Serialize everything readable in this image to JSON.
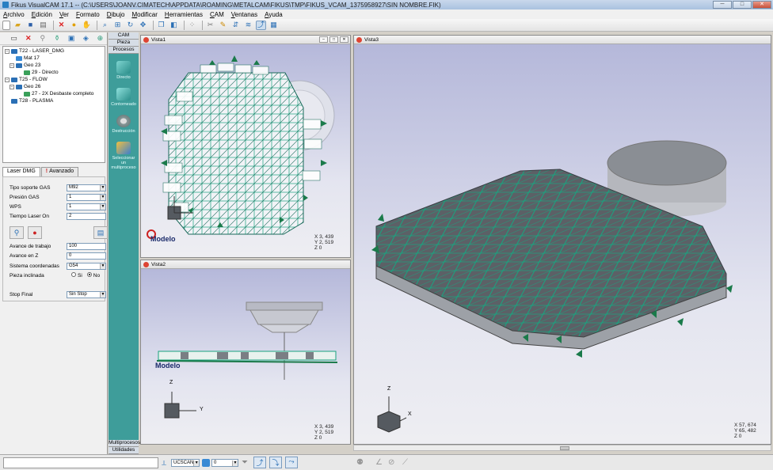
{
  "window": {
    "title": "Fikus VisualCAM 17.1 -- (C:\\USERS\\JOANV.CIMATECH\\APPDATA\\ROAMING\\METALCAM\\FIKUS\\TMP\\FIKUS_VCAM_1375958927\\SIN NOMBRE.FIK)"
  },
  "menu": [
    "Archivo",
    "Edición",
    "Ver",
    "Formato",
    "Dibujo",
    "Modificar",
    "Herramientas",
    "CAM",
    "Ventanas",
    "Ayuda"
  ],
  "toolbar_icons": [
    "new-file-icon",
    "open-folder-icon",
    "save-icon",
    "print-icon",
    "delete-icon",
    "paint-icon",
    "pan-icon",
    "zoom-icon",
    "zoom-window-icon",
    "rotate-icon",
    "move-icon",
    "view-front-icon",
    "view-iso-icon",
    "snap-icon",
    "cut-icon",
    "pen-icon",
    "measure-icon",
    "layers-icon",
    "toolpath-icon",
    "render-icon"
  ],
  "tree": [
    {
      "label": "T22 - LASER_DMG",
      "level": 0
    },
    {
      "label": "Mat 17",
      "level": 1
    },
    {
      "label": "Geo 23",
      "level": 1
    },
    {
      "label": "29 - Directo",
      "level": 2
    },
    {
      "label": "T25 - FLOW",
      "level": 0
    },
    {
      "label": "Geo 26",
      "level": 1
    },
    {
      "label": "27 - 2X Desbaste completo",
      "level": 2
    },
    {
      "label": "T28 - PLASMA",
      "level": 0
    }
  ],
  "tabs": {
    "laser": "Laser DMG",
    "advanced": "Avanzado"
  },
  "form": {
    "tipo_soporte_gas": {
      "label": "Tipo soporte GAS",
      "value": "M92"
    },
    "presion_gas": {
      "label": "Presión GAS",
      "value": "1"
    },
    "wps": {
      "label": "WPS",
      "value": "1"
    },
    "tiempo_laser": {
      "label": "Tiempo Laser On",
      "value": "2"
    },
    "avance_trabajo": {
      "label": "Avance de trabajo",
      "value": "100"
    },
    "avance_z": {
      "label": "Avance en Z",
      "value": "0"
    },
    "sistema_coord": {
      "label": "Sistema coordenadas",
      "value": "G54"
    },
    "pieza_inclinada": {
      "label": "Pieza inclinada",
      "si": "Si",
      "no": "No"
    },
    "stop_final": {
      "label": "Stop Final",
      "value": "Sin Stop"
    }
  },
  "side": {
    "cam": "CAM",
    "pieza": "Pieza",
    "procesos": "Procesos",
    "directo": "Directo",
    "contorneado": "Contorneado",
    "destruccion": "Destrucción",
    "seleccionar": "Seleccionar un multiproceso",
    "multiprocesos": "Multiprocesos",
    "utilidades": "Utilidades"
  },
  "views": {
    "v1": {
      "title": "Vista1",
      "x": "X 3, 439",
      "y": "Y 2, 519",
      "z": "Z 0",
      "modelo": "Modelo"
    },
    "v2": {
      "title": "Vista2",
      "x": "X 3, 439",
      "y": "Y 2, 519",
      "z": "Z 0",
      "modelo": "Modelo",
      "axis_z": "Z",
      "axis_y": "Y"
    },
    "v3": {
      "title": "Vista3",
      "x": "X 57, 674",
      "y": "Y 65, 482",
      "z": "Z 0",
      "axis_z": "Z",
      "axis_x": "X"
    }
  },
  "status": {
    "ucs": "UCSCAN",
    "layer": "0"
  },
  "colors": {
    "teal": "#3e9d9a",
    "viewport_top": "#b5b8da",
    "piece": "#6f7378",
    "grid": "#1aa37f"
  }
}
